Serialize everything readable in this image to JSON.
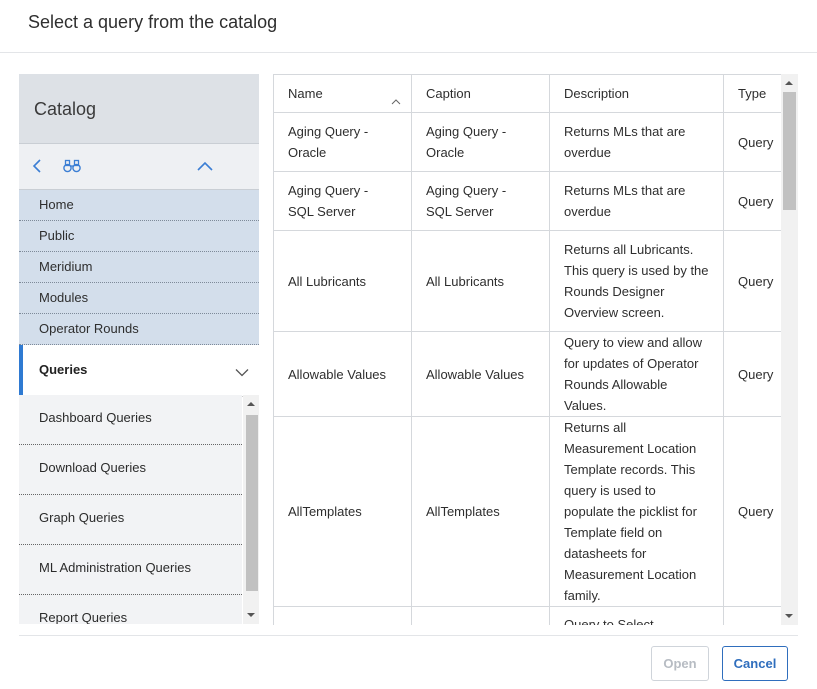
{
  "dialog": {
    "title": "Select a query from the catalog"
  },
  "catalog": {
    "title": "Catalog",
    "toolbar": {
      "back_icon": "chevron-left-icon",
      "search_icon": "binoculars-icon",
      "collapse_icon": "chevron-up-icon"
    },
    "breadcrumbs": [
      "Home",
      "Public",
      "Meridium",
      "Modules",
      "Operator Rounds"
    ],
    "active_folder": "Queries",
    "sub_items": [
      "Dashboard Queries",
      "Download Queries",
      "Graph Queries",
      "ML Administration Queries",
      "Report Queries"
    ]
  },
  "table": {
    "columns": [
      "Name",
      "Caption",
      "Description",
      "Type"
    ],
    "sorted_column": "Name",
    "sort_direction": "ascending",
    "rows": [
      {
        "name": "Aging Query - Oracle",
        "caption": "Aging Query - Oracle",
        "description": "Returns MLs that are overdue",
        "type": "Query"
      },
      {
        "name": "Aging Query - SQL Server",
        "caption": "Aging Query - SQL Server",
        "description": "Returns MLs that are overdue",
        "type": "Query"
      },
      {
        "name": "All Lubricants",
        "caption": "All Lubricants",
        "description": "Returns all Lubricants. This query is used by the Rounds Designer Overview screen.",
        "type": "Query"
      },
      {
        "name": "Allowable Values",
        "caption": "Allowable Values",
        "description": "Query to view and allow for updates of Operator Rounds Allowable Values.",
        "type": "Query"
      },
      {
        "name": "AllTemplates",
        "caption": "AllTemplates",
        "description": "Returns all Measurement Location Template records. This query is used to populate the picklist for Template field on datasheets for Measurement Location family.",
        "type": "Query"
      },
      {
        "name": "",
        "caption": "",
        "description": "Query to Select Particular",
        "type": ""
      }
    ]
  },
  "footer": {
    "open_label": "Open",
    "cancel_label": "Cancel"
  },
  "colors": {
    "accent": "#2f7ad2",
    "crumb_bg": "#d3deeb",
    "header_bg": "#dde1e6"
  }
}
